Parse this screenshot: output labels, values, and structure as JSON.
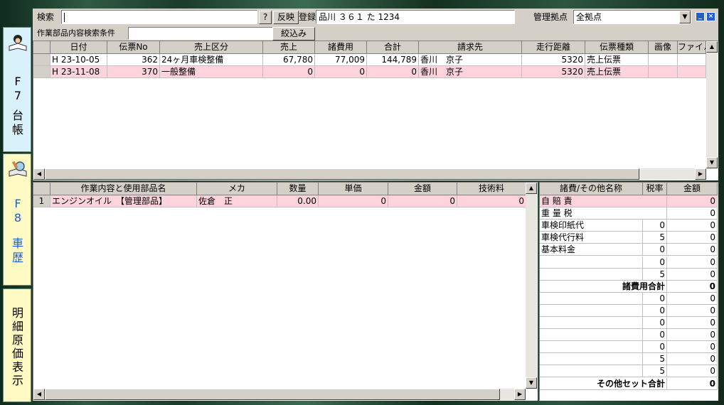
{
  "search": {
    "label": "検索",
    "value": "",
    "help_btn": "?",
    "apply_btn": "反映"
  },
  "registration": {
    "label": "登録番号",
    "value": "品川 ３６１ た 1234"
  },
  "base": {
    "label": "管理拠点",
    "value": "全拠点"
  },
  "window_controls": {
    "minimize": "_",
    "close": "×"
  },
  "filter": {
    "label": "作業部品内容検索条件",
    "value": "",
    "button": "絞込み"
  },
  "sidetabs": [
    {
      "key": "F\n7",
      "label": "台\n帳"
    },
    {
      "key": "F\n8",
      "label": "車\n歴"
    },
    {
      "label": "明\n細\n原\n価\n表\n示"
    }
  ],
  "slips_table": {
    "columns": [
      "日付",
      "伝票No",
      "売上区分",
      "売上",
      "諸費用",
      "合計",
      "請求先",
      "走行距離",
      "伝票種類",
      "画像",
      "ファイル"
    ],
    "rows": [
      [
        "H 23-10-05",
        "362",
        "24ヶ月車検整備",
        "67,780",
        "77,009",
        "144,789",
        "香川　京子",
        "5320",
        "売上伝票",
        "",
        ""
      ],
      [
        "H 23-11-08",
        "370",
        "一般整備",
        "0",
        "0",
        "0",
        "香川　京子",
        "5320",
        "売上伝票",
        "",
        ""
      ]
    ]
  },
  "work_table": {
    "columns": [
      "作業内容と使用部品名",
      "メカ",
      "数量",
      "単価",
      "金額",
      "技術料"
    ],
    "rows": [
      [
        "1",
        "エンジンオイル　【管理部品】",
        "佐倉　正",
        "0.00",
        "0",
        "0",
        "0"
      ]
    ]
  },
  "costs_table": {
    "columns": [
      "諸費/その他名称",
      "税率",
      "金額"
    ],
    "rows": [
      {
        "name": "自 賠 責",
        "rate": "",
        "amount": "0",
        "pink": true,
        "merged": true
      },
      {
        "name": "重 量 税",
        "rate": "",
        "amount": "0",
        "merged": true
      },
      {
        "name": "車検印紙代",
        "rate": "0",
        "amount": "0"
      },
      {
        "name": "車検代行料",
        "rate": "5",
        "amount": "0"
      },
      {
        "name": "基本料金",
        "rate": "0",
        "amount": "0"
      },
      {
        "name": "",
        "rate": "0",
        "amount": "0"
      },
      {
        "name": "",
        "rate": "5",
        "amount": "0"
      },
      {
        "name": "諸費用合計",
        "rate": "",
        "amount": "0",
        "total": true
      },
      {
        "name": "",
        "rate": "0",
        "amount": "0"
      },
      {
        "name": "",
        "rate": "0",
        "amount": "0"
      },
      {
        "name": "",
        "rate": "0",
        "amount": "0"
      },
      {
        "name": "",
        "rate": "0",
        "amount": "0"
      },
      {
        "name": "",
        "rate": "0",
        "amount": "0"
      },
      {
        "name": "",
        "rate": "5",
        "amount": "0"
      },
      {
        "name": "",
        "rate": "5",
        "amount": "0"
      },
      {
        "name": "その他セット合計",
        "rate": "",
        "amount": "0",
        "total": true
      }
    ]
  },
  "colors": {
    "pink_row": "#ffd3dc",
    "panel": "#d4d0c8",
    "sidetab_active": "#d9f1fb",
    "sidetab_yellow": "#fff9c4",
    "accent_blue": "#1f5fd0"
  }
}
